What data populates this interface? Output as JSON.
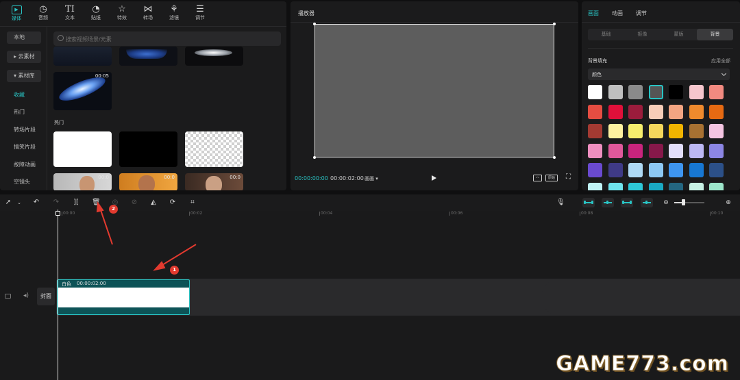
{
  "media_panel": {
    "tabs": [
      {
        "label": "媒体",
        "icon": "media-icon",
        "active": true
      },
      {
        "label": "音频",
        "icon": "audio-icon"
      },
      {
        "label": "文本",
        "icon": "text-icon"
      },
      {
        "label": "贴纸",
        "icon": "sticker-icon"
      },
      {
        "label": "特效",
        "icon": "effects-icon"
      },
      {
        "label": "转场",
        "icon": "transition-icon"
      },
      {
        "label": "滤镜",
        "icon": "filter-icon"
      },
      {
        "label": "调节",
        "icon": "adjust-icon"
      }
    ],
    "sidebar": [
      "本地",
      "▸ 云素材",
      "▾ 素材库",
      "收藏",
      "热门",
      "转场片段",
      "搞笑片段",
      "故障动画",
      "空镜头"
    ],
    "search_placeholder": "搜索视频场景/元素",
    "section_hot": "热门",
    "thumb_durations": [
      "00:05",
      "00:0",
      "00:0"
    ]
  },
  "player": {
    "title": "播放器",
    "time_current": "00:00:00:00",
    "time_total": "00:00:02:00",
    "ratio_label": "画画 ▾",
    "original_label": "原始"
  },
  "props": {
    "tabs": [
      "画面",
      "动画",
      "调节"
    ],
    "subtabs": [
      "基础",
      "抠像",
      "蒙版",
      "背景"
    ],
    "fill_title": "背景填充",
    "apply_all": "应用全部",
    "fill_type": "颜色",
    "swatches": [
      "#ffffff",
      "#bfbfbf",
      "#8a8a8a",
      "#555555",
      "#000000",
      "#f6c6cc",
      "#f28a80",
      "#e54d42",
      "#e0103a",
      "#9b1c3c",
      "#f7cdb8",
      "#f3a582",
      "#ef8a2d",
      "#e76a12",
      "#a33a32",
      "#fef2a0",
      "#f6ee6d",
      "#f5d75c",
      "#f1b400",
      "#a77132",
      "#f5c5e2",
      "#ef8fc0",
      "#e0589b",
      "#c8247d",
      "#86184a",
      "#e2defb",
      "#bcb8f4",
      "#8c86e4",
      "#6a4ad0",
      "#3f3a86",
      "#aed9f4",
      "#8dc8f3",
      "#3e95f0",
      "#1777d2",
      "#2c5088",
      "#bff3f5",
      "#6fe3ec",
      "#2ec7d7",
      "#1aa9c3",
      "#246680",
      "#c7f1e4",
      "#9de6cb"
    ]
  },
  "timeline": {
    "ticks": [
      "00:00",
      "00:02",
      "00:04",
      "00:06",
      "00:08",
      "00:10"
    ],
    "clip_name": "白色",
    "clip_duration": "00:00:02:00",
    "cover_label": "封面"
  },
  "annotations": [
    "1",
    "2"
  ],
  "watermark": "GAME773.com",
  "colors": {
    "accent": "#29c4c4",
    "annotation": "#e23a2f"
  }
}
